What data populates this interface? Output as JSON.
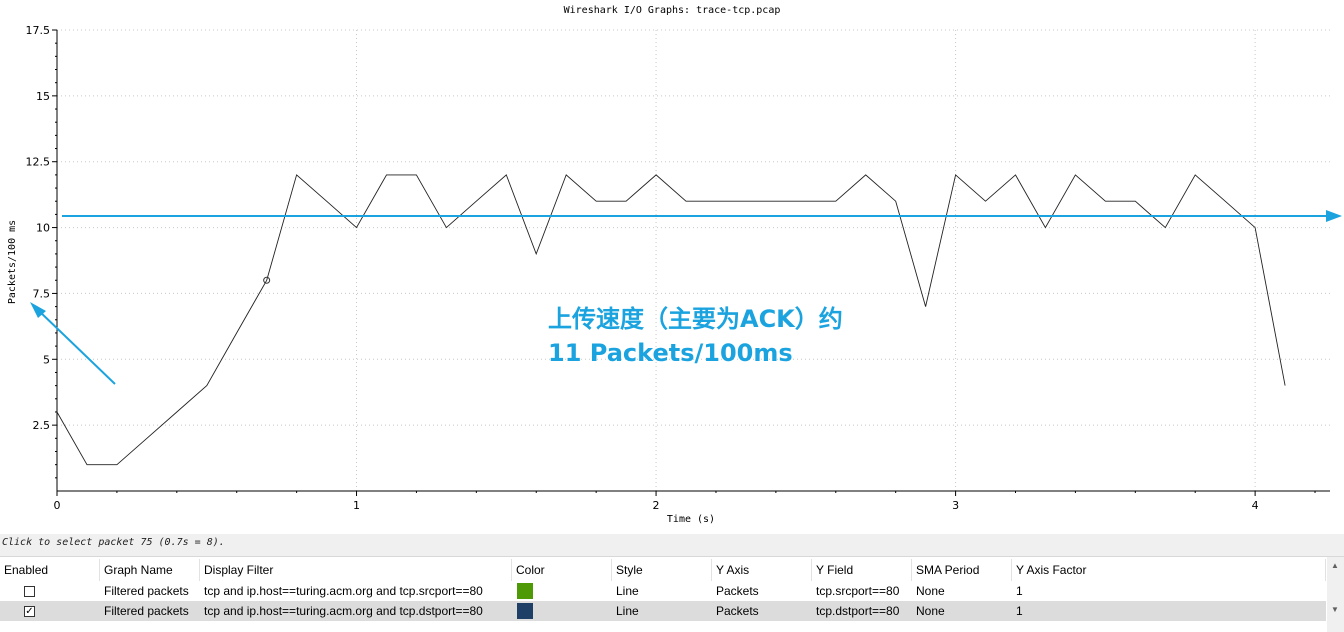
{
  "window": {
    "title": "Wireshark I/O Graphs: trace-tcp.pcap",
    "status_text": "Click to select packet 75 (0.7s = 8)."
  },
  "annotation": {
    "line1": "上传速度（主要为ACK）约",
    "line2": "11 Packets/100ms",
    "color": "#1aa3df",
    "average_value": 10.9
  },
  "chart_data": {
    "type": "line",
    "title": "Wireshark I/O Graphs: trace-tcp.pcap",
    "xlabel": "Time (s)",
    "ylabel": "Packets/100 ms",
    "xlim": [
      0,
      4.25
    ],
    "ylim": [
      0,
      17.5
    ],
    "x_ticks": [
      "0",
      "1",
      "2",
      "3",
      "4"
    ],
    "y_ticks": [
      "2.5",
      "5",
      "7.5",
      "10",
      "12.5",
      "15",
      "17.5"
    ],
    "grid": true,
    "series": [
      {
        "color": "#222222",
        "x": [
          0,
          0.1,
          0.2,
          0.3,
          0.4,
          0.5,
          0.6,
          0.7,
          0.8,
          0.9,
          1.0,
          1.1,
          1.2,
          1.3,
          1.4,
          1.5,
          1.6,
          1.7,
          1.8,
          1.9,
          2.0,
          2.1,
          2.2,
          2.3,
          2.4,
          2.5,
          2.6,
          2.7,
          2.8,
          2.9,
          3.0,
          3.1,
          3.2,
          3.3,
          3.4,
          3.5,
          3.6,
          3.7,
          3.8,
          3.9,
          4.0,
          4.1
        ],
        "y": [
          3,
          1,
          1,
          2,
          3,
          4,
          6,
          8,
          12,
          11,
          10,
          12,
          12,
          10,
          11,
          12,
          9,
          12,
          11,
          11,
          12,
          11,
          11,
          11,
          11,
          11,
          11,
          12,
          11,
          7,
          12,
          11,
          12,
          10,
          12,
          11,
          11,
          10,
          12,
          11,
          10,
          4
        ],
        "selected_point": {
          "x": 0.7,
          "y": 8
        }
      }
    ]
  },
  "table": {
    "headers": [
      "Enabled",
      "Graph Name",
      "Display Filter",
      "Color",
      "Style",
      "Y Axis",
      "Y Field",
      "SMA Period",
      "Y Axis Factor"
    ],
    "rows": [
      {
        "enabled": false,
        "name": "Filtered packets",
        "filter": "tcp and ip.host==turing.acm.org and tcp.srcport==80",
        "color": "#4e9a06",
        "style": "Line",
        "y_axis": "Packets",
        "y_field": "tcp.srcport==80",
        "sma": "None",
        "factor": "1"
      },
      {
        "enabled": true,
        "name": "Filtered packets",
        "filter": "tcp and ip.host==turing.acm.org and tcp.dstport==80",
        "color": "#1f3f66",
        "style": "Line",
        "y_axis": "Packets",
        "y_field": "tcp.dstport==80",
        "sma": "None",
        "factor": "1"
      }
    ]
  }
}
